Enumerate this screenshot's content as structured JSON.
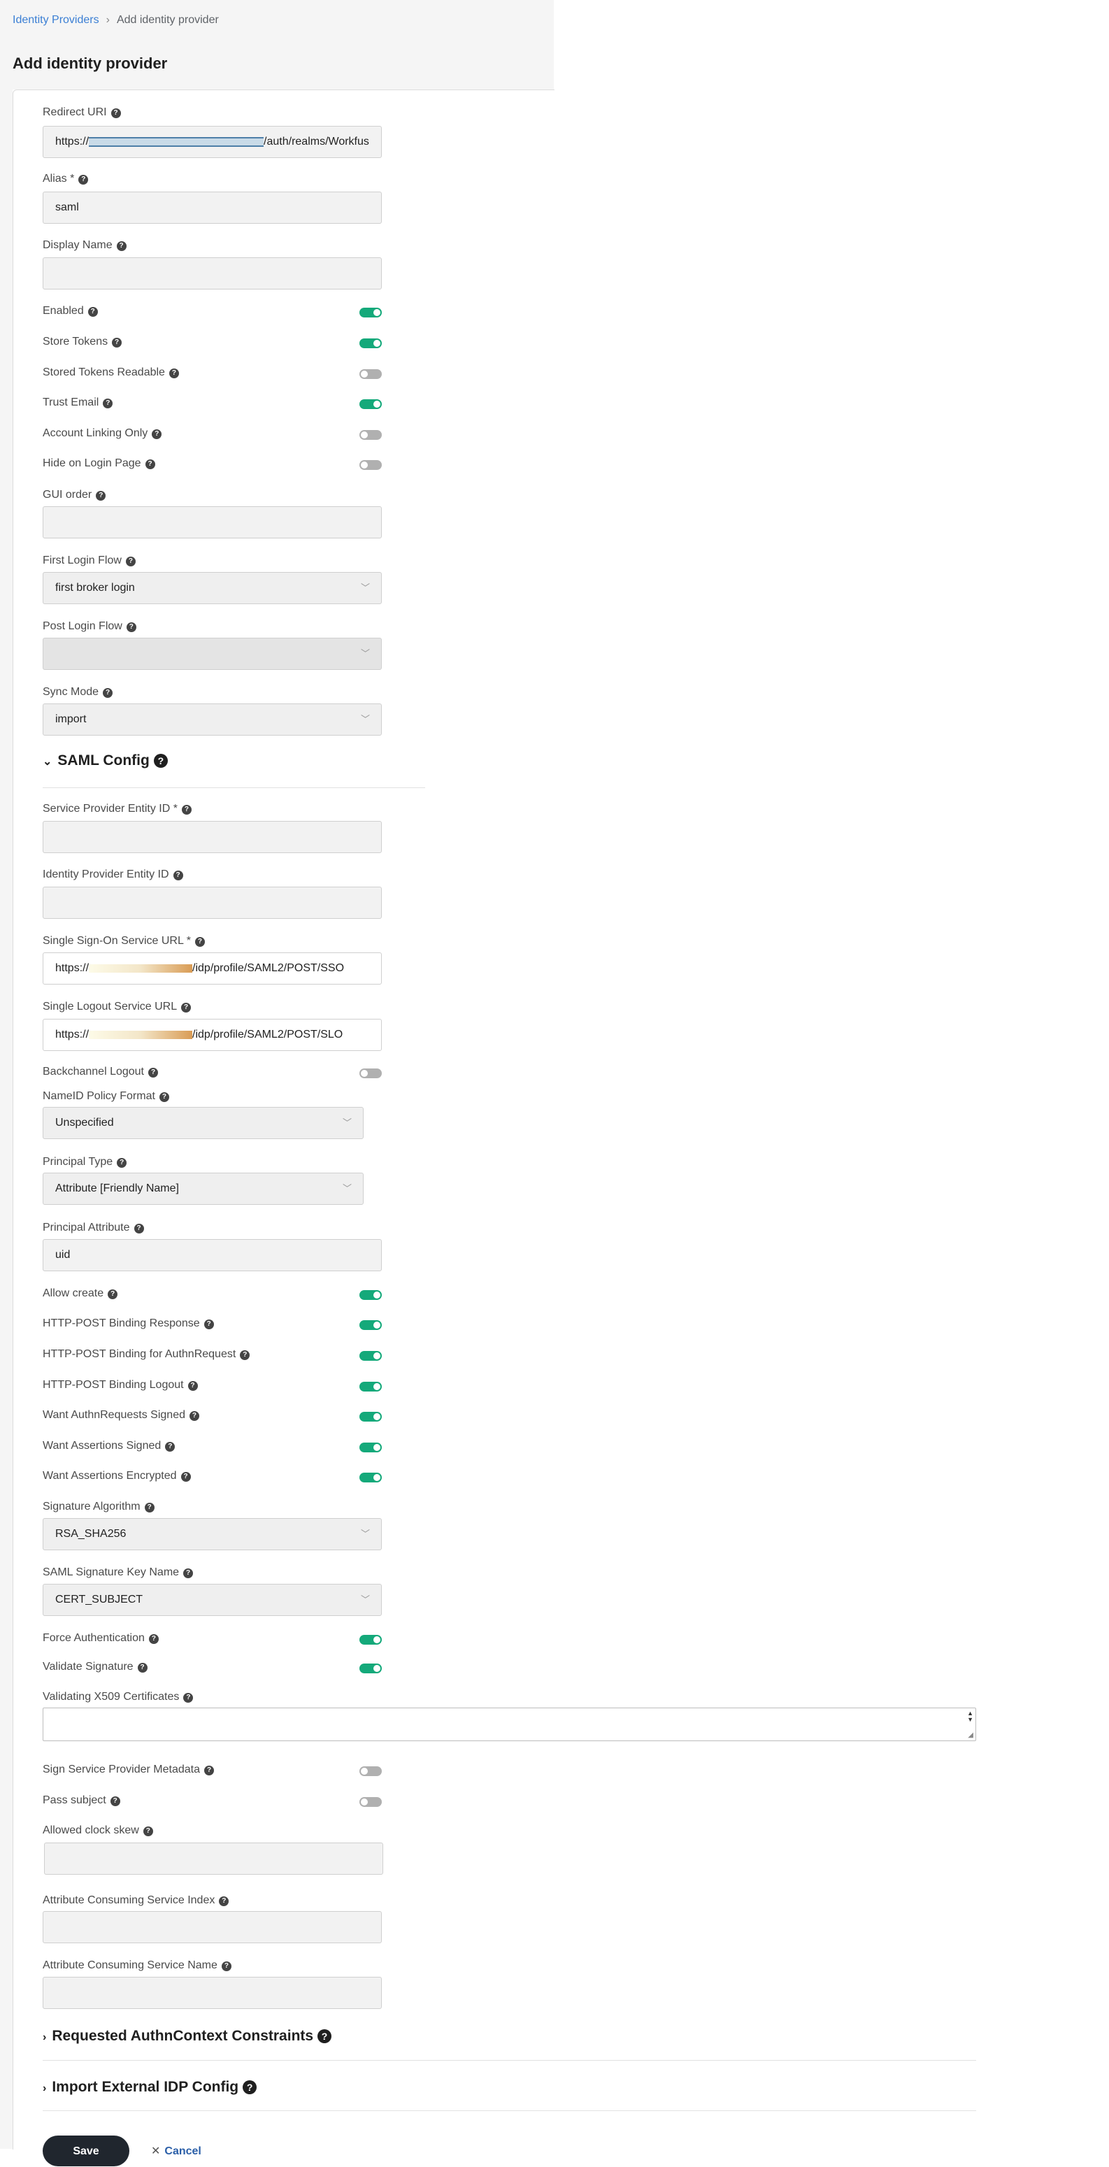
{
  "breadcrumb": {
    "parent": "Identity Providers",
    "current": "Add identity provider"
  },
  "page_title": "Add identity provider",
  "general": {
    "redirect_uri": {
      "label": "Redirect URI",
      "value_prefix": "https://",
      "value_suffix": "/auth/realms/Workfus"
    },
    "alias": {
      "label": "Alias *",
      "value": "saml"
    },
    "display_name": {
      "label": "Display Name",
      "value": ""
    },
    "enabled": {
      "label": "Enabled",
      "on": true
    },
    "store_tokens": {
      "label": "Store Tokens",
      "on": true
    },
    "stored_tokens_readable": {
      "label": "Stored Tokens Readable",
      "on": false
    },
    "trust_email": {
      "label": "Trust Email",
      "on": true
    },
    "account_linking_only": {
      "label": "Account Linking Only",
      "on": false
    },
    "hide_on_login_page": {
      "label": "Hide on Login Page",
      "on": false
    },
    "gui_order": {
      "label": "GUI order",
      "value": ""
    },
    "first_login_flow": {
      "label": "First Login Flow",
      "value": "first broker login"
    },
    "post_login_flow": {
      "label": "Post Login Flow",
      "value": ""
    },
    "sync_mode": {
      "label": "Sync Mode",
      "value": "import"
    }
  },
  "saml_config": {
    "title": "SAML Config",
    "sp_entity_id": {
      "label": "Service Provider Entity ID *",
      "value": ""
    },
    "idp_entity_id": {
      "label": "Identity Provider Entity ID",
      "value": ""
    },
    "sso_url": {
      "label": "Single Sign-On Service URL *",
      "value_prefix": "https://",
      "value_suffix": "/idp/profile/SAML2/POST/SSO"
    },
    "slo_url": {
      "label": "Single Logout Service URL",
      "value_prefix": "https://",
      "value_suffix": "/idp/profile/SAML2/POST/SLO"
    },
    "backchannel_logout": {
      "label": "Backchannel Logout",
      "on": false
    },
    "nameid_policy_format": {
      "label": "NameID Policy Format",
      "value": "Unspecified"
    },
    "principal_type": {
      "label": "Principal Type",
      "value": "Attribute [Friendly Name]"
    },
    "principal_attribute": {
      "label": "Principal Attribute",
      "value": "uid"
    },
    "allow_create": {
      "label": "Allow create",
      "on": true
    },
    "http_post_binding_response": {
      "label": "HTTP-POST Binding Response",
      "on": true
    },
    "http_post_binding_authn": {
      "label": "HTTP-POST Binding for AuthnRequest",
      "on": true
    },
    "http_post_binding_logout": {
      "label": "HTTP-POST Binding Logout",
      "on": true
    },
    "want_authn_signed": {
      "label": "Want AuthnRequests Signed",
      "on": true
    },
    "want_assertions_signed": {
      "label": "Want Assertions Signed",
      "on": true
    },
    "want_assertions_encrypted": {
      "label": "Want Assertions Encrypted",
      "on": true
    },
    "signature_algorithm": {
      "label": "Signature Algorithm",
      "value": "RSA_SHA256"
    },
    "saml_signature_key_name": {
      "label": "SAML Signature Key Name",
      "value": "CERT_SUBJECT"
    },
    "force_authentication": {
      "label": "Force Authentication",
      "on": true
    },
    "validate_signature": {
      "label": "Validate Signature",
      "on": true
    },
    "validating_x509": {
      "label": "Validating X509 Certificates",
      "value": ""
    },
    "sign_sp_metadata": {
      "label": "Sign Service Provider Metadata",
      "on": false
    },
    "pass_subject": {
      "label": "Pass subject",
      "on": false
    },
    "allowed_clock_skew": {
      "label": "Allowed clock skew",
      "value": ""
    },
    "attr_consuming_index": {
      "label": "Attribute Consuming Service Index",
      "value": ""
    },
    "attr_consuming_name": {
      "label": "Attribute Consuming Service Name",
      "value": ""
    }
  },
  "sections": {
    "requested_authn": "Requested AuthnContext Constraints",
    "import_external": "Import External IDP Config"
  },
  "icons": {
    "help": "?",
    "chevron_down": "﹀",
    "caret_down": "⌄",
    "caret_right": "›",
    "close": "✕",
    "spin_up": "▲",
    "spin_down": "▼",
    "resize": "◢"
  },
  "actions": {
    "save": "Save",
    "cancel": "Cancel"
  },
  "colors": {
    "toggle_on": "#14a97a",
    "toggle_off": "#b0b0b0",
    "link": "#3b7fd4",
    "save_bg": "#20262e"
  }
}
